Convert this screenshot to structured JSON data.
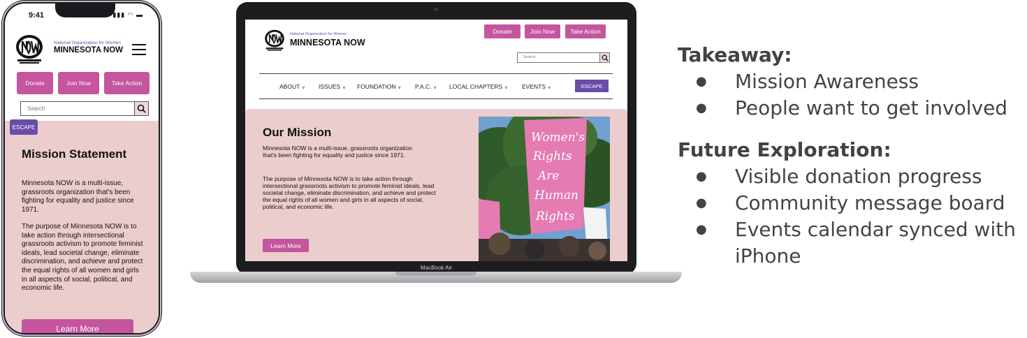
{
  "phone": {
    "status_time": "9:41",
    "org_small": "National Organization for Women",
    "org_big": "MINNESOTA NOW",
    "buttons": [
      "Donate",
      "Join Now",
      "Take Action"
    ],
    "search_placeholder": "Search",
    "escape_label": "ESCAPE",
    "heading": "Mission Statement",
    "para1": "Minnesota NOW is a multi-issue, grassroots organization that's been fighting for equality and justice since 1971.",
    "para2": "The purpose of Minnesota NOW is to take action through intersectional grassroots activism to promote feminist ideals, lead societal change, eliminate discrimination, and achieve and protect the equal rights of all women and girls in all aspects of social, political, and economic life.",
    "learn_more": "Learn More"
  },
  "laptop": {
    "model_label": "MacBook Air",
    "org_small": "National Organization for Women",
    "org_big": "MINNESOTA NOW",
    "buttons": [
      "Donate",
      "Join Now",
      "Take Action"
    ],
    "search_placeholder": "Search",
    "nav": [
      "ABOUT",
      "ISSUES",
      "FOUNDATION",
      "P.A.C.",
      "LOCAL CHAPTERS",
      "EVENTS"
    ],
    "escape_label": "ESCAPE",
    "heading": "Our Mission",
    "para1": "Minnesota NOW is a multi-issue, grassroots organization that's been fighting for equality and justice since 1971.",
    "para2": "The purpose of Minnesota NOW is to take action through intersectional grassroots activism to promote feminist ideals, lead societal change, eliminate discrimination, and achieve and protect the equal rights of all women and girls in all aspects of social, political, and economic life.",
    "learn_more": "Learn More",
    "photo_sign_text": [
      "Women's",
      "Rights",
      "Are",
      "Human",
      "Rights"
    ]
  },
  "notes": {
    "takeaway_title": "Takeaway:",
    "takeaway_items": [
      "Mission Awareness",
      "People want to get involved"
    ],
    "future_title": "Future Exploration:",
    "future_items": [
      "Visible donation progress",
      "Community message board",
      "Events calendar synced with iPhone"
    ]
  },
  "colors": {
    "brand_pink": "#c4559e",
    "escape_purple": "#6a4da8",
    "content_bg": "#eccdcd",
    "notes_text": "#434343"
  }
}
